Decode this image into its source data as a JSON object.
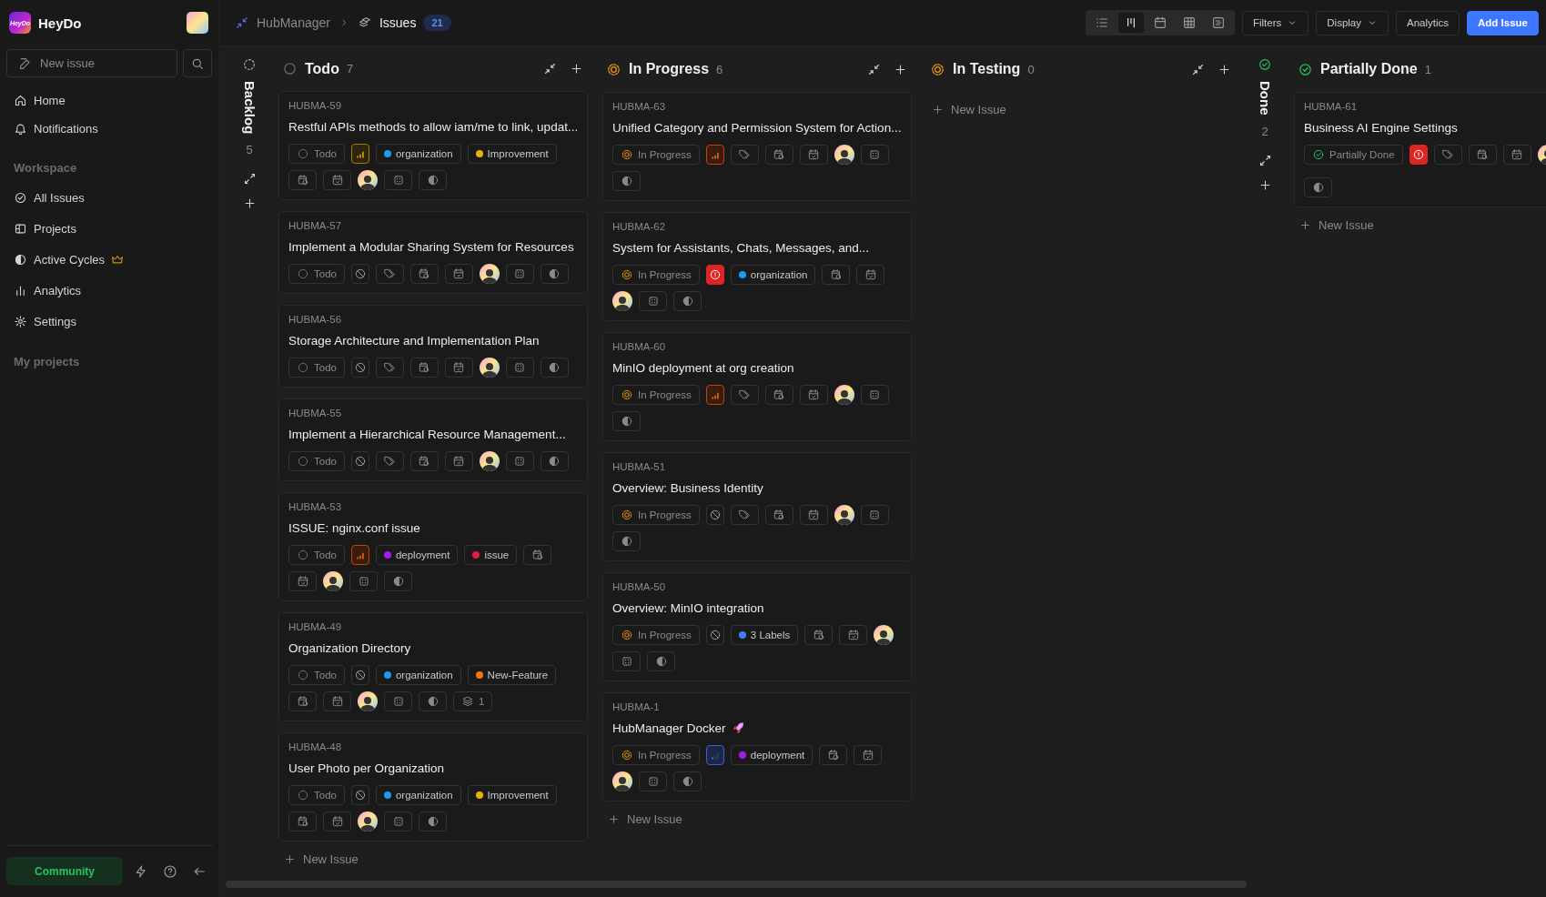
{
  "sidebar": {
    "brand": "HeyDo",
    "logo_text": "HeyDo",
    "new_issue": "New issue",
    "nav": [
      {
        "kind": "home",
        "label": "Home"
      },
      {
        "kind": "notifications",
        "label": "Notifications"
      }
    ],
    "workspace_title": "Workspace",
    "workspace": [
      {
        "kind": "issues",
        "label": "All Issues"
      },
      {
        "kind": "projects",
        "label": "Projects"
      },
      {
        "kind": "cycles",
        "label": "Active Cycles"
      },
      {
        "kind": "analytics",
        "label": "Analytics"
      },
      {
        "kind": "settings",
        "label": "Settings"
      }
    ],
    "projects_title": "My projects",
    "community": "Community"
  },
  "topbar": {
    "project": "HubManager",
    "page": "Issues",
    "count": "21",
    "layouts": [
      {
        "kind": "list",
        "selected": false
      },
      {
        "kind": "kanban",
        "selected": true
      },
      {
        "kind": "calendar",
        "selected": false
      },
      {
        "kind": "spreadsheet",
        "selected": false
      },
      {
        "kind": "gantt",
        "selected": false
      }
    ],
    "filters": "Filters",
    "display": "Display",
    "analytics": "Analytics",
    "add_issue": "Add Issue"
  },
  "columns": [
    {
      "title": "Backlog",
      "count": "5",
      "kind": "backlog",
      "collapsed": true
    },
    {
      "title": "Todo",
      "count": "7",
      "kind": "todo",
      "collapsed": false,
      "actions": true,
      "new_issue": "New Issue",
      "cards": [
        {
          "id": "HUBMA-59",
          "title": "Restful APIs methods to allow iam/me to link, updat...",
          "props": [
            {
              "kind": "state_todo",
              "text": "Todo"
            },
            {
              "kind": "priority_medium"
            },
            {
              "kind": "label",
              "color": "#1d9bf0",
              "text": "organization"
            },
            {
              "kind": "label",
              "color": "#eab308",
              "text": "Improvement"
            },
            {
              "kind": "start_date"
            },
            {
              "kind": "due_date"
            },
            {
              "kind": "assignee"
            },
            {
              "kind": "module"
            },
            {
              "kind": "cycle"
            }
          ]
        },
        {
          "id": "HUBMA-57",
          "title": "Implement a Modular Sharing System for Resources",
          "props": [
            {
              "kind": "state_todo",
              "text": "Todo"
            },
            {
              "kind": "priority_none"
            },
            {
              "kind": "labels"
            },
            {
              "kind": "start_date"
            },
            {
              "kind": "due_date"
            },
            {
              "kind": "assignee"
            },
            {
              "kind": "module"
            },
            {
              "kind": "cycle"
            }
          ]
        },
        {
          "id": "HUBMA-56",
          "title": "Storage Architecture and Implementation Plan",
          "props": [
            {
              "kind": "state_todo",
              "text": "Todo"
            },
            {
              "kind": "priority_none"
            },
            {
              "kind": "labels"
            },
            {
              "kind": "start_date"
            },
            {
              "kind": "due_date"
            },
            {
              "kind": "assignee"
            },
            {
              "kind": "module"
            },
            {
              "kind": "cycle"
            }
          ]
        },
        {
          "id": "HUBMA-55",
          "title": "Implement a Hierarchical Resource Management...",
          "props": [
            {
              "kind": "state_todo",
              "text": "Todo"
            },
            {
              "kind": "priority_none"
            },
            {
              "kind": "labels"
            },
            {
              "kind": "start_date"
            },
            {
              "kind": "due_date"
            },
            {
              "kind": "assignee"
            },
            {
              "kind": "module"
            },
            {
              "kind": "cycle"
            }
          ]
        },
        {
          "id": "HUBMA-53",
          "title": "ISSUE: nginx.conf issue",
          "props": [
            {
              "kind": "state_todo",
              "text": "Todo"
            },
            {
              "kind": "priority_high"
            },
            {
              "kind": "label",
              "color": "#a21cf0",
              "text": "deployment"
            },
            {
              "kind": "label",
              "color": "#e11d48",
              "text": "issue"
            },
            {
              "kind": "start_date"
            },
            {
              "kind": "due_date"
            },
            {
              "kind": "assignee"
            },
            {
              "kind": "module"
            },
            {
              "kind": "cycle"
            }
          ]
        },
        {
          "id": "HUBMA-49",
          "title": "Organization Directory",
          "props": [
            {
              "kind": "state_todo",
              "text": "Todo"
            },
            {
              "kind": "priority_none"
            },
            {
              "kind": "label",
              "color": "#1d9bf0",
              "text": "organization"
            },
            {
              "kind": "label",
              "color": "#f97316",
              "text": "New-Feature"
            },
            {
              "kind": "start_date"
            },
            {
              "kind": "due_date"
            },
            {
              "kind": "assignee"
            },
            {
              "kind": "module"
            },
            {
              "kind": "cycle"
            },
            {
              "kind": "sub_issues",
              "text": "1"
            }
          ]
        },
        {
          "id": "HUBMA-48",
          "title": "User Photo per Organization",
          "props": [
            {
              "kind": "state_todo",
              "text": "Todo"
            },
            {
              "kind": "priority_none"
            },
            {
              "kind": "label",
              "color": "#1d9bf0",
              "text": "organization"
            },
            {
              "kind": "label",
              "color": "#eab308",
              "text": "Improvement"
            },
            {
              "kind": "start_date"
            },
            {
              "kind": "due_date"
            },
            {
              "kind": "assignee"
            },
            {
              "kind": "module"
            },
            {
              "kind": "cycle"
            }
          ]
        }
      ]
    },
    {
      "title": "In Progress",
      "count": "6",
      "kind": "in_progress",
      "collapsed": false,
      "actions": true,
      "new_issue": "New Issue",
      "cards": [
        {
          "id": "HUBMA-63",
          "title": "Unified Category and Permission System for Action...",
          "props": [
            {
              "kind": "state_in_progress",
              "text": "In Progress"
            },
            {
              "kind": "priority_high"
            },
            {
              "kind": "labels"
            },
            {
              "kind": "start_date"
            },
            {
              "kind": "due_date"
            },
            {
              "kind": "assignee"
            },
            {
              "kind": "module"
            },
            {
              "kind": "cycle"
            }
          ]
        },
        {
          "id": "HUBMA-62",
          "title": "System for Assistants, Chats, Messages, and...",
          "props": [
            {
              "kind": "state_in_progress",
              "text": "In Progress"
            },
            {
              "kind": "priority_urgent"
            },
            {
              "kind": "label",
              "color": "#1d9bf0",
              "text": "organization"
            },
            {
              "kind": "start_date"
            },
            {
              "kind": "due_date"
            },
            {
              "kind": "assignee"
            },
            {
              "kind": "module"
            },
            {
              "kind": "cycle"
            }
          ]
        },
        {
          "id": "HUBMA-60",
          "title": "MinIO deployment at org creation",
          "props": [
            {
              "kind": "state_in_progress",
              "text": "In Progress"
            },
            {
              "kind": "priority_high"
            },
            {
              "kind": "labels"
            },
            {
              "kind": "start_date"
            },
            {
              "kind": "due_date"
            },
            {
              "kind": "assignee"
            },
            {
              "kind": "module"
            },
            {
              "kind": "cycle"
            }
          ]
        },
        {
          "id": "HUBMA-51",
          "title": "Overview: Business Identity",
          "props": [
            {
              "kind": "state_in_progress",
              "text": "In Progress"
            },
            {
              "kind": "priority_none"
            },
            {
              "kind": "labels"
            },
            {
              "kind": "start_date"
            },
            {
              "kind": "due_date"
            },
            {
              "kind": "assignee"
            },
            {
              "kind": "module"
            },
            {
              "kind": "cycle"
            }
          ]
        },
        {
          "id": "HUBMA-50",
          "title": "Overview: MinIO integration",
          "props": [
            {
              "kind": "state_in_progress",
              "text": "In Progress"
            },
            {
              "kind": "priority_none"
            },
            {
              "kind": "label",
              "color": "#3b82f6",
              "text": "3 Labels"
            },
            {
              "kind": "start_date"
            },
            {
              "kind": "due_date"
            },
            {
              "kind": "assignee"
            },
            {
              "kind": "module"
            },
            {
              "kind": "cycle"
            }
          ]
        },
        {
          "id": "HUBMA-1",
          "title": "HubManager Docker",
          "title_icon": true,
          "props": [
            {
              "kind": "state_in_progress",
              "text": "In Progress"
            },
            {
              "kind": "priority_low"
            },
            {
              "kind": "label",
              "color": "#a21cf0",
              "text": "deployment"
            },
            {
              "kind": "start_date"
            },
            {
              "kind": "due_date"
            },
            {
              "kind": "assignee"
            },
            {
              "kind": "module"
            },
            {
              "kind": "cycle"
            }
          ]
        }
      ]
    },
    {
      "title": "In Testing",
      "count": "0",
      "kind": "in_progress",
      "collapsed": false,
      "actions": true,
      "new_issue": "New Issue"
    },
    {
      "title": "Done",
      "count": "2",
      "kind": "done",
      "collapsed": true
    },
    {
      "title": "Partially Done",
      "count": "1",
      "kind": "done",
      "collapsed": false,
      "new_issue": "New Issue",
      "cards": [
        {
          "id": "HUBMA-61",
          "title": "Business AI Engine Settings",
          "props": [
            {
              "kind": "state_done",
              "text": "Partially Done"
            },
            {
              "kind": "priority_urgent"
            },
            {
              "kind": "labels"
            },
            {
              "kind": "start_date"
            },
            {
              "kind": "due_date"
            },
            {
              "kind": "assignee"
            },
            {
              "kind": "line_break"
            },
            {
              "kind": "cycle"
            }
          ]
        }
      ]
    }
  ]
}
